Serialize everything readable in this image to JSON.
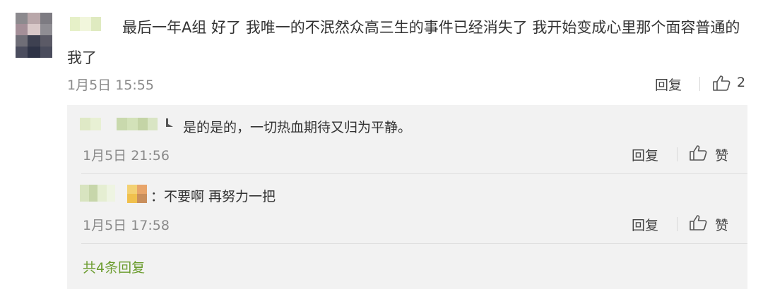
{
  "comment": {
    "text": "最后一年A组 好了 我唯一的不泯然众高三生的事件已经消失了 我开始变成心里那个面容普通的我了",
    "time": "1月5日 15:55",
    "reply_label": "回复",
    "like_count": "2"
  },
  "replies": [
    {
      "text": "是的是的，一切热血期待又归为平静。",
      "time": "1月5日 21:56",
      "reply_label": "回复",
      "like_label": "赞"
    },
    {
      "text": "：不要啊  再努力一把",
      "time": "1月5日 17:58",
      "reply_label": "回复",
      "like_label": "赞"
    }
  ],
  "more_replies": "共4条回复",
  "colors": {
    "link_green": "#6b9c2e",
    "reply_bg": "#f2f2f2",
    "meta_gray": "#8a8a8a"
  },
  "icons": {
    "like": "thumbs-up-icon"
  }
}
